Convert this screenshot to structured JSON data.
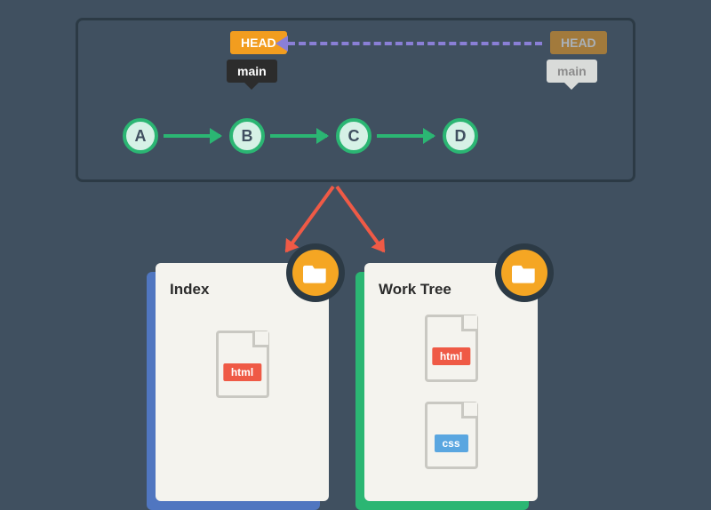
{
  "commits": {
    "a": "A",
    "b": "B",
    "c": "C",
    "d": "D"
  },
  "labels": {
    "head_active": "HEAD",
    "branch_active": "main",
    "head_ghost": "HEAD",
    "branch_ghost": "main"
  },
  "cards": {
    "index": {
      "title": "Index",
      "accent": "#5076c0",
      "files": [
        "html"
      ]
    },
    "worktree": {
      "title": "Work Tree",
      "accent": "#2bb673",
      "files": [
        "html",
        "css"
      ]
    }
  },
  "file_labels": {
    "html": "html",
    "css": "css"
  }
}
